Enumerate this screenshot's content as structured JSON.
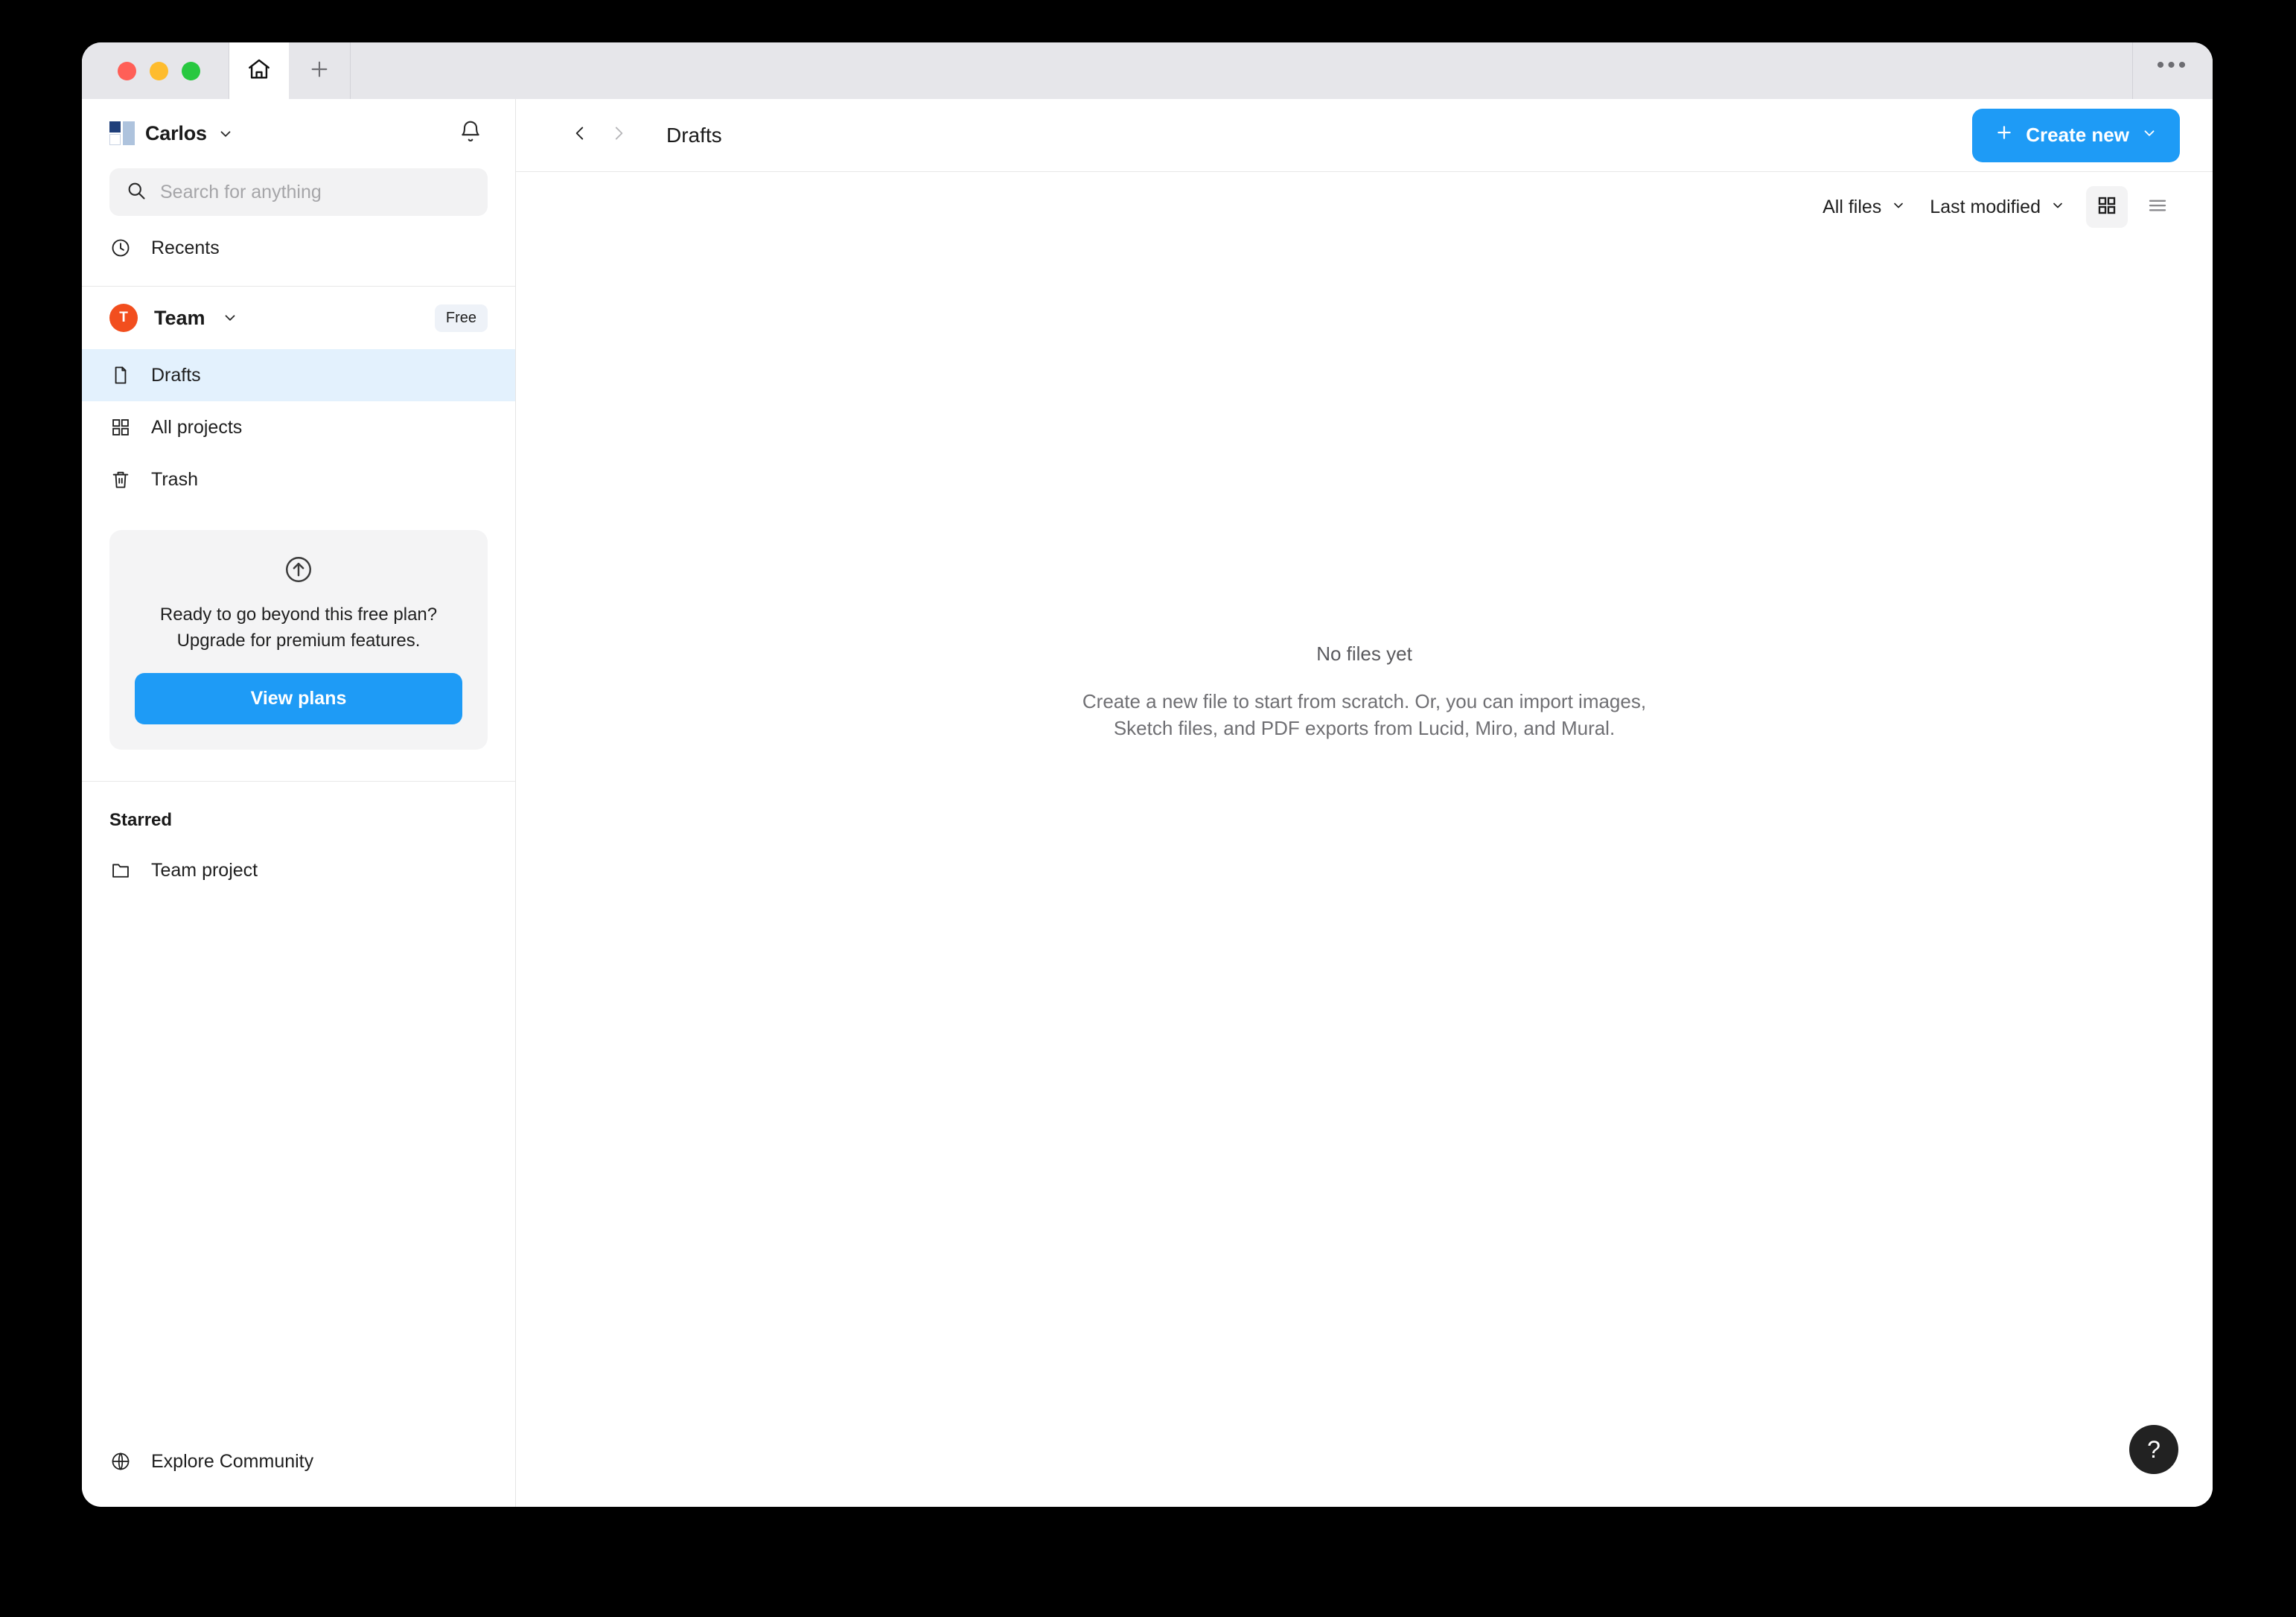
{
  "window": {
    "titlebar": {
      "traffic_lights": [
        "close",
        "minimize",
        "maximize"
      ],
      "home_tab_icon": "home-icon",
      "new_tab_icon": "plus-icon",
      "more_label": "•••"
    }
  },
  "sidebar": {
    "account": {
      "name": "Carlos",
      "logo_icon": "app-logo-icon",
      "chevron_icon": "chevron-down-icon",
      "notifications_icon": "bell-icon"
    },
    "search": {
      "placeholder": "Search for anything",
      "icon": "search-icon"
    },
    "quick_nav": [
      {
        "label": "Recents",
        "icon": "clock-icon"
      }
    ],
    "team": {
      "avatar_initial": "T",
      "name": "Team",
      "chevron_icon": "chevron-down-icon",
      "plan_badge": "Free",
      "avatar_color": "#f24e1e"
    },
    "team_nav": [
      {
        "label": "Drafts",
        "icon": "file-icon",
        "active": true
      },
      {
        "label": "All projects",
        "icon": "grid-icon",
        "active": false
      },
      {
        "label": "Trash",
        "icon": "trash-icon",
        "active": false
      }
    ],
    "upgrade_card": {
      "icon": "arrow-up-circle-icon",
      "line1": "Ready to go beyond this free plan?",
      "line2": "Upgrade for premium features.",
      "button_label": "View plans",
      "button_color": "#1e9bf6"
    },
    "starred": {
      "title": "Starred",
      "items": [
        {
          "label": "Team project",
          "icon": "folder-icon"
        }
      ]
    },
    "footer": {
      "label": "Explore Community",
      "icon": "globe-icon"
    }
  },
  "main": {
    "header": {
      "back_icon": "chevron-left-icon",
      "forward_icon": "chevron-right-icon",
      "title": "Drafts",
      "create_button": {
        "plus_icon": "plus-icon",
        "label": "Create new",
        "chevron_icon": "chevron-down-icon",
        "color": "#1e9bf6"
      }
    },
    "toolbar": {
      "filter_label": "All files",
      "filter_chevron": "chevron-down-icon",
      "sort_label": "Last modified",
      "sort_chevron": "chevron-down-icon",
      "grid_view_icon": "grid-view-icon",
      "list_view_icon": "list-view-icon",
      "active_view": "grid"
    },
    "empty_state": {
      "title": "No files yet",
      "description": "Create a new file to start from scratch. Or, you can import images, Sketch files, and PDF exports from Lucid, Miro, and Mural."
    },
    "help_button": {
      "label": "?",
      "icon": "question-mark-icon"
    }
  }
}
